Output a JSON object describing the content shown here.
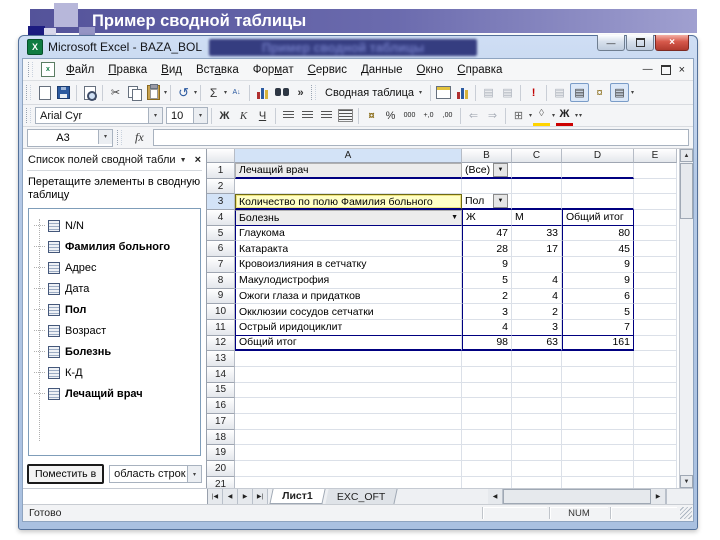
{
  "slide": {
    "title": "Пример сводной таблицы"
  },
  "window": {
    "title": "Microsoft Excel - BAZA_BOL"
  },
  "colors": {
    "accent_navy": "#000080",
    "slide_band_from": "#54539a",
    "slide_band_to": "#a0a0d0",
    "selection_fill": "#ffffc6",
    "close_button_red": "#c0392b",
    "fill_color_swatch": "#ffd400",
    "font_color_swatch": "#cc0000"
  },
  "icons": {
    "dropdown": "▼",
    "dropdown_small": "▾",
    "cut": "✂",
    "undo": "↺",
    "sum": "Σ",
    "sort": "А↓",
    "chevron": "»",
    "refresh": "!",
    "grid": "▤",
    "list": "▤",
    "borders": "⊞",
    "fill": "◊",
    "currency": "¤",
    "percent": "%",
    "thousands": "000",
    "inc_decimal": "+,0",
    "dec_decimal": ",00",
    "indent_left": "⇐",
    "indent_right": "⇒",
    "minimize": "—",
    "close": "×",
    "app_x": "X",
    "doc_x": "x",
    "up": "▲",
    "down": "▼",
    "left": "◀",
    "right": "▶",
    "tab_first": "|◀",
    "tab_prev": "◀",
    "tab_next": "▶",
    "tab_last": "▶|"
  },
  "menu": {
    "items": [
      {
        "pre": "",
        "key": "Ф",
        "post": "айл"
      },
      {
        "pre": "",
        "key": "П",
        "post": "равка"
      },
      {
        "pre": "",
        "key": "В",
        "post": "ид"
      },
      {
        "pre": "Вст",
        "key": "а",
        "post": "вка"
      },
      {
        "pre": "Фор",
        "key": "м",
        "post": "ат"
      },
      {
        "pre": "",
        "key": "С",
        "post": "ервис"
      },
      {
        "pre": "",
        "key": "Д",
        "post": "анные"
      },
      {
        "pre": "",
        "key": "О",
        "post": "кно"
      },
      {
        "pre": "",
        "key": "С",
        "post": "правка"
      }
    ]
  },
  "toolbars": {
    "pivot_label": "Сводная таблица",
    "font_name": "Arial Cyr",
    "font_size": "10",
    "bold": "Ж",
    "italic": "К",
    "underline": "Ч"
  },
  "formula_bar": {
    "name_box": "A3",
    "fx": "fx",
    "value": ""
  },
  "task_pane": {
    "title": "Список полей сводной табли",
    "hint": "Перетащите элементы в сводную таблицу",
    "fields": [
      {
        "label": "N/N",
        "bold": false
      },
      {
        "label": "Фамилия больного",
        "bold": true
      },
      {
        "label": "Адрес",
        "bold": false
      },
      {
        "label": "Дата",
        "bold": false
      },
      {
        "label": "Пол",
        "bold": true
      },
      {
        "label": "Возраст",
        "bold": false
      },
      {
        "label": "Болезнь",
        "bold": true
      },
      {
        "label": "К-Д",
        "bold": false
      },
      {
        "label": "Лечащий врач",
        "bold": true
      }
    ],
    "add_button": "Поместить в",
    "area_combo": "область строк"
  },
  "sheet": {
    "columns": [
      "A",
      "B",
      "C",
      "D",
      "E"
    ],
    "row_count": 21,
    "pivot": {
      "page_field": "Лечащий врач",
      "page_value": "(Все)",
      "data_field": "Количество по полю Фамилия больного",
      "col_field": "Пол",
      "row_field": "Болезнь",
      "col_headers": [
        "Ж",
        "М",
        "Общий итог"
      ],
      "data_rows": [
        {
          "label": "Глаукома",
          "values": [
            "47",
            "33",
            "80"
          ]
        },
        {
          "label": "Катаракта",
          "values": [
            "28",
            "17",
            "45"
          ]
        },
        {
          "label": "Кровоизлияния в сетчатку",
          "values": [
            "9",
            "",
            "9"
          ]
        },
        {
          "label": "Макулодистрофия",
          "values": [
            "5",
            "4",
            "9"
          ]
        },
        {
          "label": "Ожоги глаза и придатков",
          "values": [
            "2",
            "4",
            "6"
          ]
        },
        {
          "label": "Окклюзии сосудов сетчатки",
          "values": [
            "3",
            "2",
            "5"
          ]
        },
        {
          "label": "Острый иридоциклит",
          "values": [
            "4",
            "3",
            "7"
          ]
        }
      ],
      "total_row": {
        "label": "Общий итог",
        "values": [
          "98",
          "63",
          "161"
        ]
      }
    },
    "tabs": [
      {
        "label": "Лист1",
        "active": true
      },
      {
        "label": "EXC_OFT",
        "active": false
      }
    ]
  },
  "status_bar": {
    "mode": "Готово",
    "num": "NUM"
  }
}
